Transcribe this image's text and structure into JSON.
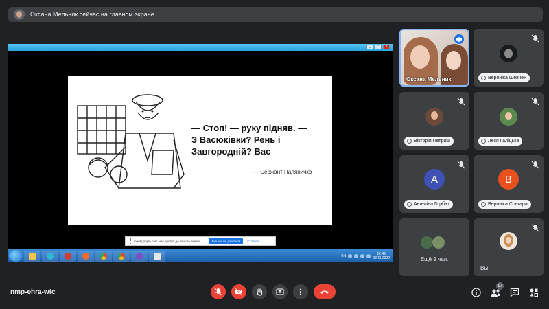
{
  "banner": {
    "text": "Оксана Мельник сейчас на главном экране"
  },
  "slide": {
    "quote_lines": [
      "— Стоп! — руку підняв. —",
      "З Васюківки? Рень і",
      "Завгородній? Вас"
    ],
    "author": "— Сержант Паляничко"
  },
  "share_bar": {
    "message": "meet.google.com має доступ до вашого екрана.",
    "stop_label": "Більше не ділитися",
    "hide_label": "Сховати"
  },
  "taskbar": {
    "lang": "EN",
    "time": "12:49",
    "date": "08.11.2022"
  },
  "tiles": [
    {
      "name": "Оксана Мельник",
      "state": "speaking"
    },
    {
      "name": "Вероніка Шевчен",
      "state": "muted"
    },
    {
      "name": "Вікторія Петриш",
      "state": "muted"
    },
    {
      "name": "Леся Галіцька",
      "state": "muted"
    },
    {
      "name": "Ангеліна Горбат",
      "letter": "A",
      "color": "#3f51b5",
      "state": "muted"
    },
    {
      "name": "Вероніка Сонгара",
      "letter": "B",
      "color": "#e8511e",
      "state": "muted"
    },
    {
      "name": "Ещё 9 чел."
    },
    {
      "name": "Вы",
      "state": "muted"
    }
  ],
  "bottom": {
    "meeting_code": "nmp-ehra-wtc",
    "participants_count": "17"
  },
  "colors": {
    "background": "#202124",
    "tile": "#3c4043",
    "danger": "#ea4335",
    "accent": "#1a73e8"
  }
}
